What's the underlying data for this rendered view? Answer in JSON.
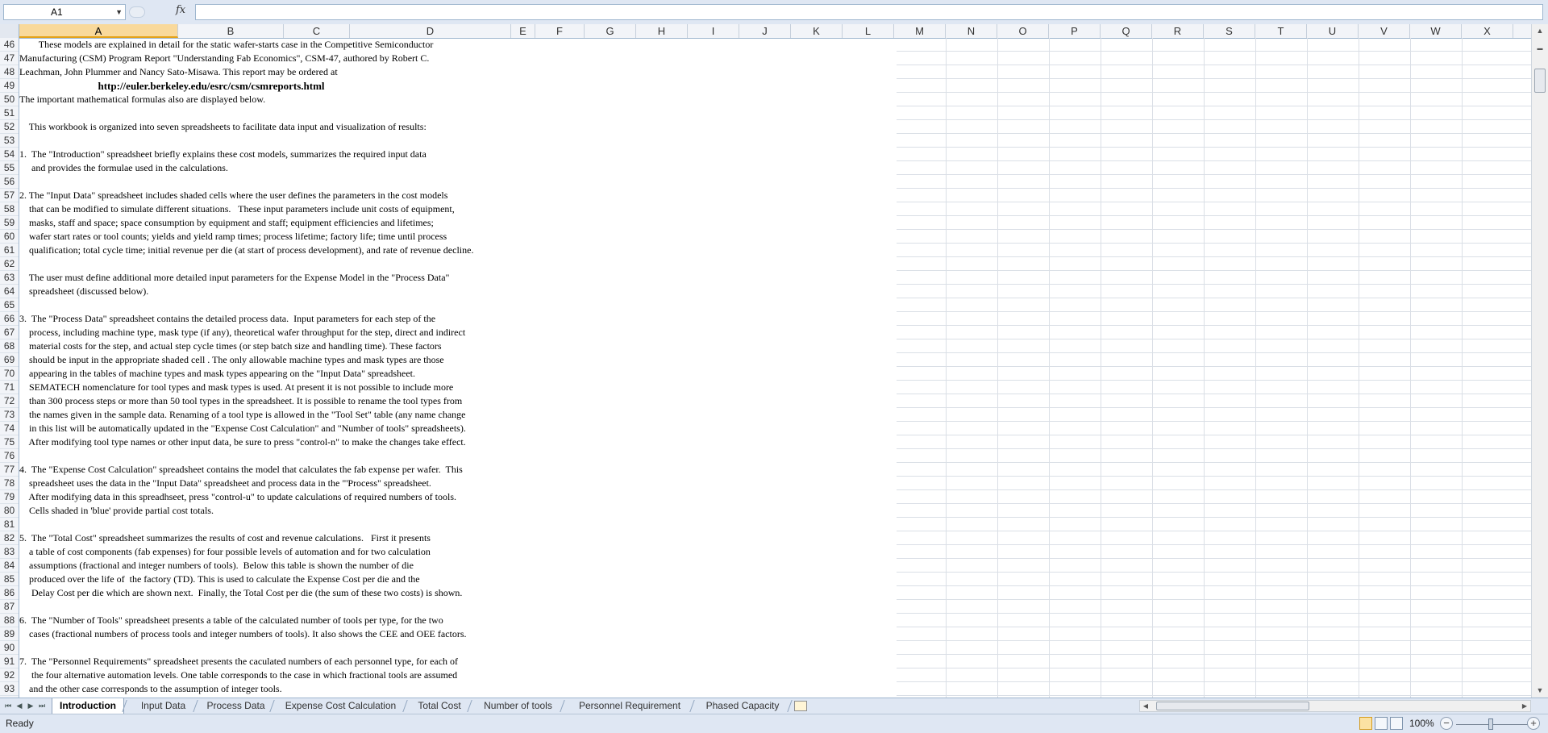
{
  "formula_bar": {
    "name_box": "A1",
    "fx_label": "fx",
    "formula": ""
  },
  "columns": [
    "A",
    "B",
    "C",
    "D",
    "E",
    "F",
    "G",
    "H",
    "I",
    "J",
    "K",
    "L",
    "M",
    "N",
    "O",
    "P",
    "Q",
    "R",
    "S",
    "T",
    "U",
    "V",
    "W",
    "X"
  ],
  "active_column": "A",
  "rows": [
    {
      "n": "46",
      "t": "        These models are explained in detail for the static wafer-starts case in the Competitive Semiconductor"
    },
    {
      "n": "47",
      "t": "Manufacturing (CSM) Program Report \"Understanding Fab Economics\", CSM-47, authored by Robert C."
    },
    {
      "n": "48",
      "t": "Leachman, John Plummer and Nancy Sato-Misawa. This report may be ordered at"
    },
    {
      "n": "49",
      "t": "                              http://euler.berkeley.edu/esrc/csm/csmreports.html",
      "link": true
    },
    {
      "n": "50",
      "t": "The important mathematical formulas also are displayed below."
    },
    {
      "n": "51",
      "t": ""
    },
    {
      "n": "52",
      "t": "    This workbook is organized into seven spreadsheets to facilitate data input and visualization of results:"
    },
    {
      "n": "53",
      "t": ""
    },
    {
      "n": "54",
      "t": "1.  The \"Introduction\" spreadsheet briefly explains these cost models, summarizes the required input data"
    },
    {
      "n": "55",
      "t": "     and provides the formulae used in the calculations."
    },
    {
      "n": "56",
      "t": ""
    },
    {
      "n": "57",
      "t": "2. The \"Input Data\" spreadsheet includes shaded cells where the user defines the parameters in the cost models"
    },
    {
      "n": "58",
      "t": "    that can be modified to simulate different situations.   These input parameters include unit costs of equipment,"
    },
    {
      "n": "59",
      "t": "    masks, staff and space; space consumption by equipment and staff; equipment efficiencies and lifetimes;"
    },
    {
      "n": "60",
      "t": "    wafer start rates or tool counts; yields and yield ramp times; process lifetime; factory life; time until process"
    },
    {
      "n": "61",
      "t": "    qualification; total cycle time; initial revenue per die (at start of process development), and rate of revenue decline."
    },
    {
      "n": "62",
      "t": ""
    },
    {
      "n": "63",
      "t": "    The user must define additional more detailed input parameters for the Expense Model in the \"Process Data\""
    },
    {
      "n": "64",
      "t": "    spreadsheet (discussed below)."
    },
    {
      "n": "65",
      "t": ""
    },
    {
      "n": "66",
      "t": "3.  The \"Process Data\" spreadsheet contains the detailed process data.  Input parameters for each step of the"
    },
    {
      "n": "67",
      "t": "    process, including machine type, mask type (if any), theoretical wafer throughput for the step, direct and indirect"
    },
    {
      "n": "68",
      "t": "    material costs for the step, and actual step cycle times (or step batch size and handling time). These factors"
    },
    {
      "n": "69",
      "t": "    should be input in the appropriate shaded cell . The only allowable machine types and mask types are those"
    },
    {
      "n": "70",
      "t": "    appearing in the tables of machine types and mask types appearing on the \"Input Data\" spreadsheet."
    },
    {
      "n": "71",
      "t": "    SEMATECH nomenclature for tool types and mask types is used. At present it is not possible to include more"
    },
    {
      "n": "72",
      "t": "    than 300 process steps or more than 50 tool types in the spreadsheet. It is possible to rename the tool types from"
    },
    {
      "n": "73",
      "t": "    the names given in the sample data. Renaming of a tool type is allowed in the \"Tool Set\" table (any name change"
    },
    {
      "n": "74",
      "t": "    in this list will be automatically updated in the \"Expense Cost Calculation\" and \"Number of tools\" spreadsheets)."
    },
    {
      "n": "75",
      "t": "    After modifying tool type names or other input data, be sure to press \"control-n\" to make the changes take effect."
    },
    {
      "n": "76",
      "t": ""
    },
    {
      "n": "77",
      "t": "4.  The \"Expense Cost Calculation\" spreadsheet contains the model that calculates the fab expense per wafer.  This"
    },
    {
      "n": "78",
      "t": "    spreadsheet uses the data in the \"Input Data\" spreadsheet and process data in the \"'Process\" spreadsheet."
    },
    {
      "n": "79",
      "t": "    After modifying data in this spreadhseet, press \"control-u\" to update calculations of required numbers of tools."
    },
    {
      "n": "80",
      "t": "    Cells shaded in 'blue' provide partial cost totals."
    },
    {
      "n": "81",
      "t": ""
    },
    {
      "n": "82",
      "t": "5.  The \"Total Cost\" spreadsheet summarizes the results of cost and revenue calculations.   First it presents"
    },
    {
      "n": "83",
      "t": "    a table of cost components (fab expenses) for four possible levels of automation and for two calculation"
    },
    {
      "n": "84",
      "t": "    assumptions (fractional and integer numbers of tools).  Below this table is shown the number of die"
    },
    {
      "n": "85",
      "t": "    produced over the life of  the factory (TD). This is used to calculate the Expense Cost per die and the"
    },
    {
      "n": "86",
      "t": "     Delay Cost per die which are shown next.  Finally, the Total Cost per die (the sum of these two costs) is shown."
    },
    {
      "n": "87",
      "t": ""
    },
    {
      "n": "88",
      "t": "6.  The \"Number of Tools\" spreadsheet presents a table of the calculated number of tools per type, for the two"
    },
    {
      "n": "89",
      "t": "    cases (fractional numbers of process tools and integer numbers of tools). It also shows the CEE and OEE factors."
    },
    {
      "n": "90",
      "t": ""
    },
    {
      "n": "91",
      "t": "7.  The \"Personnel Requirements\" spreadsheet presents the caculated numbers of each personnel type, for each of"
    },
    {
      "n": "92",
      "t": "     the four alternative automation levels. One table corresponds to the case in which fractional tools are assumed"
    },
    {
      "n": "93",
      "t": "    and the other case corresponds to the assumption of integer tools."
    }
  ],
  "sheet_tabs": [
    "Introduction",
    "Input Data",
    "Process Data",
    "Expense Cost Calculation",
    "Total Cost",
    "Number of tools",
    "Personnel Requirement",
    "Phased Capacity"
  ],
  "active_sheet": "Introduction",
  "status": {
    "ready": "Ready",
    "zoom": "100%"
  },
  "colors": {
    "chrome": "#dfe7f3",
    "active_header": "#f9d99b",
    "grid": "#dadfe6"
  }
}
